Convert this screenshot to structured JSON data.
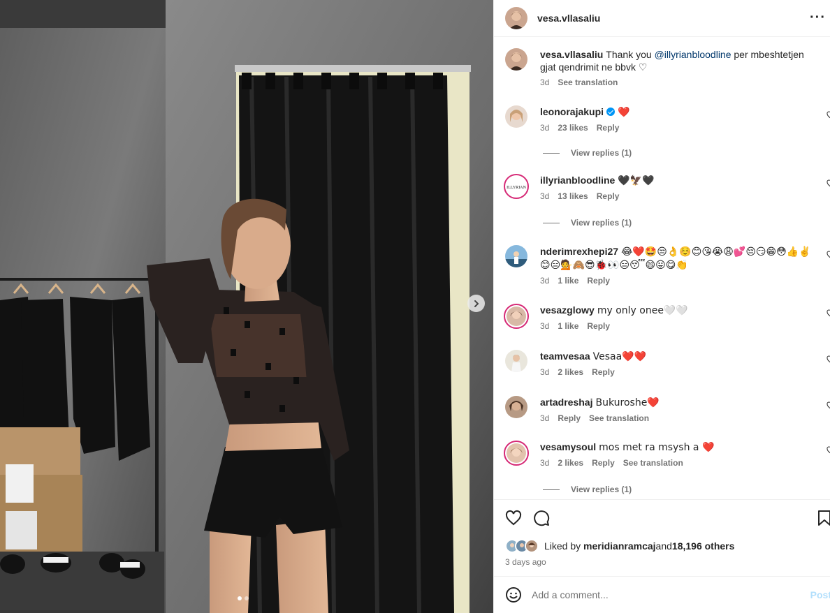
{
  "post": {
    "author": "vesa.vllasaliu",
    "more_icon": "more-horizontal-icon",
    "caption_user": "vesa.vllasaliu",
    "caption_text_1": "Thank you ",
    "caption_mention": "@illyrianbloodline",
    "caption_text_2": " per mbeshtetjen gjat qendrimit ne bbvk ♡",
    "caption_time": "3d",
    "caption_translate": "See translation",
    "carousel": {
      "current": 1,
      "total": 2
    }
  },
  "comments": [
    {
      "user": "leonorajakupi",
      "verified": true,
      "text": "❤️",
      "time": "3d",
      "likes": "23 likes",
      "reply": "Reply",
      "replies": "View replies (1)"
    },
    {
      "user": "illyrianbloodline",
      "text": "🖤🦅🖤",
      "time": "3d",
      "likes": "13 likes",
      "reply": "Reply",
      "replies": "View replies (1)"
    },
    {
      "user": "nderimrexhepi27",
      "text": "😂❤️🤩😒👌☺️😊😘😭😩💕😔😏😁😳👍✌️😊😑💁🙈😎🐞👀😑😴😄😛😋👏",
      "time": "3d",
      "likes": "1 like",
      "reply": "Reply"
    },
    {
      "user": "vesazglowy",
      "text": "my only onee🤍🤍",
      "time": "3d",
      "likes": "1 like",
      "reply": "Reply"
    },
    {
      "user": "teamvesaa",
      "text": "Vesaa❤️❤️",
      "time": "3d",
      "likes": "2 likes",
      "reply": "Reply"
    },
    {
      "user": "artadreshaj",
      "text": "Bukuroshe❤️",
      "time": "3d",
      "reply": "Reply",
      "translate": "See translation"
    },
    {
      "user": "vesamysoul",
      "text": "mos met ra msysh a ❤️",
      "time": "3d",
      "likes": "2 likes",
      "reply": "Reply",
      "translate": "See translation",
      "replies": "View replies (1)"
    }
  ],
  "actions": {
    "liked_by_prefix": "Liked by ",
    "liked_by_user": "meridianramcaj",
    "liked_by_mid": " and ",
    "liked_by_count": "18,196 others",
    "posted_ago": "3 days ago"
  },
  "add_comment": {
    "placeholder": "Add a comment...",
    "post_label": "Post"
  },
  "colors": {
    "link": "#00376b",
    "secondary": "#737373",
    "post_disabled": "#b2dffc",
    "heart_red": "#ff3040"
  }
}
